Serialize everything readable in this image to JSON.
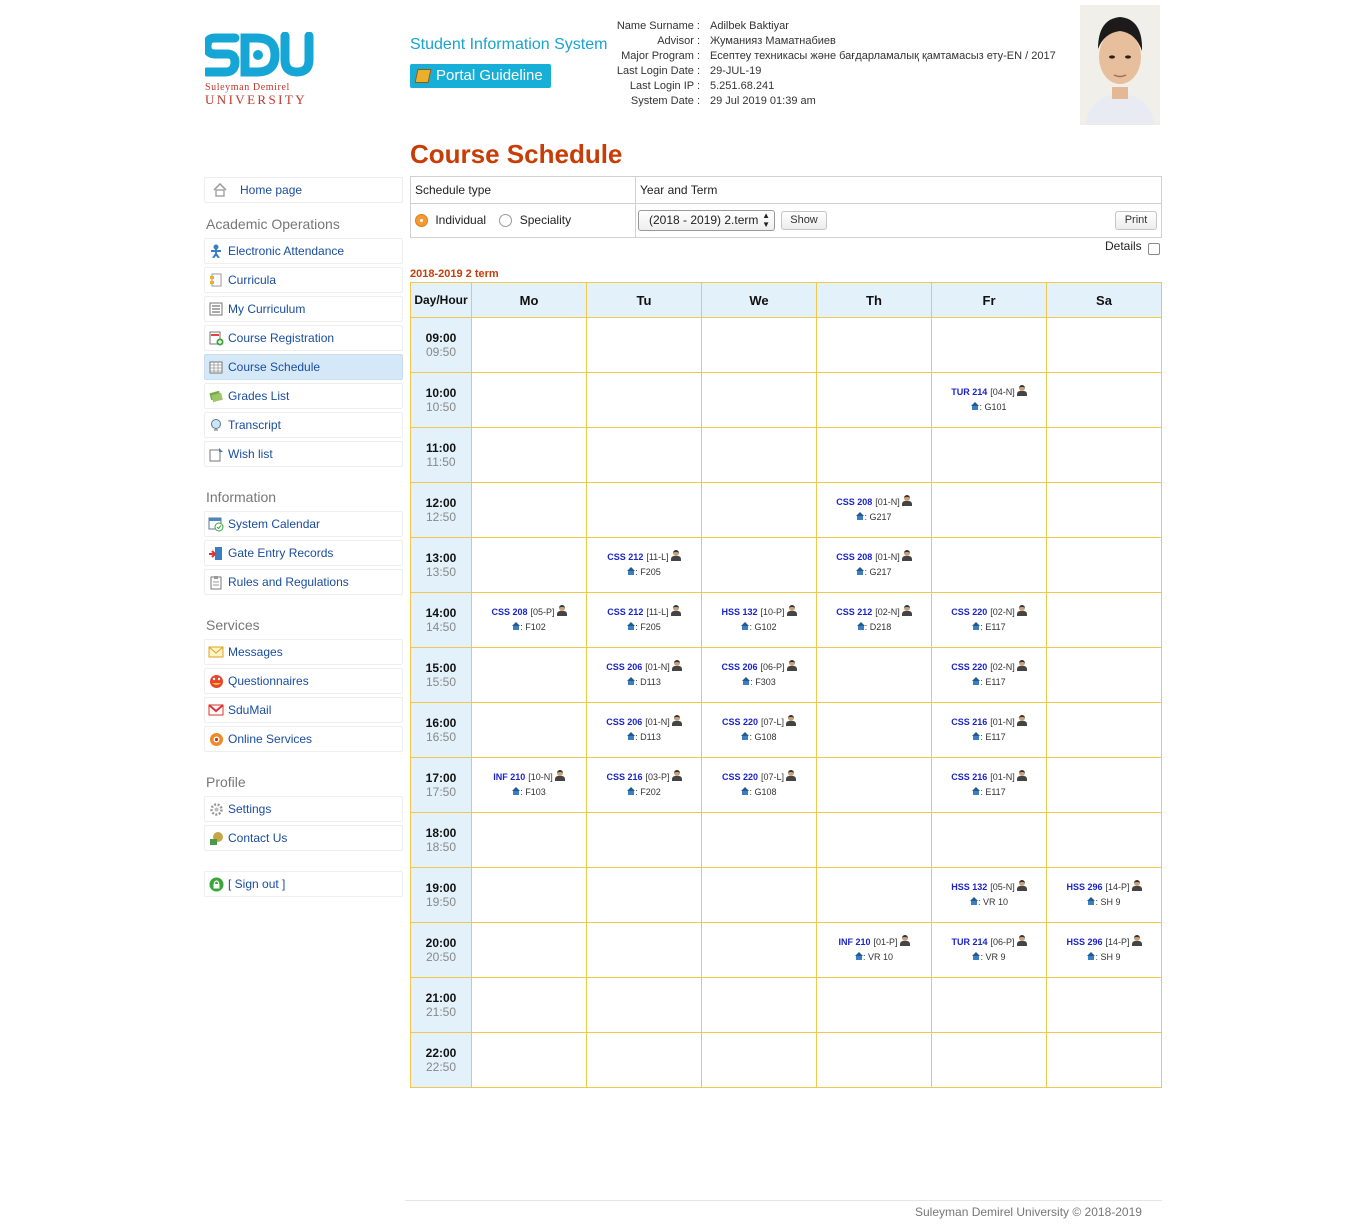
{
  "header": {
    "logo_text": "SDU",
    "university_line1": "Suleyman Demirel",
    "university_line2": "UNIVERSITY",
    "system_title": "Student Information System",
    "portal_guideline": "Portal Guideline",
    "user_info": [
      {
        "label": "Name Surname :",
        "value": "Adilbek Baktiyar"
      },
      {
        "label": "Advisor :",
        "value": "Жуманияз Маматнабиев"
      },
      {
        "label": "Major Program :",
        "value": "Есептеу техникасы және бағдарламалық қамтамасыз ету-EN / 2017"
      },
      {
        "label": "Last Login Date :",
        "value": "29-JUL-19"
      },
      {
        "label": "Last Login IP :",
        "value": "5.251.68.241"
      },
      {
        "label": "System Date :",
        "value": "29 Jul 2019 01:39 am"
      }
    ]
  },
  "page_title": "Course Schedule",
  "sidebar": {
    "home": "Home page",
    "sections": {
      "academic": "Academic Operations",
      "information": "Information",
      "services": "Services",
      "profile": "Profile"
    },
    "academic_items": [
      "Electronic Attendance",
      "Curricula",
      "My Curriculum",
      "Course Registration",
      "Course Schedule",
      "Grades List",
      "Transcript",
      "Wish list"
    ],
    "information_items": [
      "System Calendar",
      "Gate Entry Records",
      "Rules and Regulations"
    ],
    "services_items": [
      "Messages",
      "Questionnaires",
      "SduMail",
      "Online Services"
    ],
    "profile_items": [
      "Settings",
      "Contact Us"
    ],
    "sign_out": "[ Sign out ]",
    "active_item": "Course Schedule"
  },
  "filter": {
    "schedule_type_label": "Schedule type",
    "year_term_label": "Year and Term",
    "option_individual": "Individual",
    "option_speciality": "Speciality",
    "selected_type": "Individual",
    "term_select": "(2018 - 2019) 2.term",
    "show_button": "Show",
    "print_button": "Print",
    "details_label": "Details",
    "details_checked": false
  },
  "schedule": {
    "term_label": "2018-2019 2 term",
    "corner_header": "Day/Hour",
    "days": [
      "Mo",
      "Tu",
      "We",
      "Th",
      "Fr",
      "Sa"
    ],
    "hours": [
      {
        "start": "09:00",
        "end": "09:50"
      },
      {
        "start": "10:00",
        "end": "10:50"
      },
      {
        "start": "11:00",
        "end": "11:50"
      },
      {
        "start": "12:00",
        "end": "12:50"
      },
      {
        "start": "13:00",
        "end": "13:50"
      },
      {
        "start": "14:00",
        "end": "14:50"
      },
      {
        "start": "15:00",
        "end": "15:50"
      },
      {
        "start": "16:00",
        "end": "16:50"
      },
      {
        "start": "17:00",
        "end": "17:50"
      },
      {
        "start": "18:00",
        "end": "18:50"
      },
      {
        "start": "19:00",
        "end": "19:50"
      },
      {
        "start": "20:00",
        "end": "20:50"
      },
      {
        "start": "21:00",
        "end": "21:50"
      },
      {
        "start": "22:00",
        "end": "22:50"
      }
    ],
    "lessons": [
      {
        "hour": "10:00",
        "day": "Fr",
        "course": "TUR 214",
        "section": "[04-N]",
        "room": "G101"
      },
      {
        "hour": "12:00",
        "day": "Th",
        "course": "CSS 208",
        "section": "[01-N]",
        "room": "G217"
      },
      {
        "hour": "13:00",
        "day": "Tu",
        "course": "CSS 212",
        "section": "[11-L]",
        "room": "F205"
      },
      {
        "hour": "13:00",
        "day": "Th",
        "course": "CSS 208",
        "section": "[01-N]",
        "room": "G217"
      },
      {
        "hour": "14:00",
        "day": "Mo",
        "course": "CSS 208",
        "section": "[05-P]",
        "room": "F102"
      },
      {
        "hour": "14:00",
        "day": "Tu",
        "course": "CSS 212",
        "section": "[11-L]",
        "room": "F205"
      },
      {
        "hour": "14:00",
        "day": "We",
        "course": "HSS 132",
        "section": "[10-P]",
        "room": "G102"
      },
      {
        "hour": "14:00",
        "day": "Th",
        "course": "CSS 212",
        "section": "[02-N]",
        "room": "D218"
      },
      {
        "hour": "14:00",
        "day": "Fr",
        "course": "CSS 220",
        "section": "[02-N]",
        "room": "E117"
      },
      {
        "hour": "15:00",
        "day": "Tu",
        "course": "CSS 206",
        "section": "[01-N]",
        "room": "D113"
      },
      {
        "hour": "15:00",
        "day": "We",
        "course": "CSS 206",
        "section": "[06-P]",
        "room": "F303"
      },
      {
        "hour": "15:00",
        "day": "Fr",
        "course": "CSS 220",
        "section": "[02-N]",
        "room": "E117"
      },
      {
        "hour": "16:00",
        "day": "Tu",
        "course": "CSS 206",
        "section": "[01-N]",
        "room": "D113"
      },
      {
        "hour": "16:00",
        "day": "We",
        "course": "CSS 220",
        "section": "[07-L]",
        "room": "G108"
      },
      {
        "hour": "16:00",
        "day": "Fr",
        "course": "CSS 216",
        "section": "[01-N]",
        "room": "E117"
      },
      {
        "hour": "17:00",
        "day": "Mo",
        "course": "INF 210",
        "section": "[10-N]",
        "room": "F103"
      },
      {
        "hour": "17:00",
        "day": "Tu",
        "course": "CSS 216",
        "section": "[03-P]",
        "room": "F202"
      },
      {
        "hour": "17:00",
        "day": "We",
        "course": "CSS 220",
        "section": "[07-L]",
        "room": "G108"
      },
      {
        "hour": "17:00",
        "day": "Fr",
        "course": "CSS 216",
        "section": "[01-N]",
        "room": "E117"
      },
      {
        "hour": "19:00",
        "day": "Fr",
        "course": "HSS 132",
        "section": "[05-N]",
        "room": "VR 10"
      },
      {
        "hour": "19:00",
        "day": "Sa",
        "course": "HSS 296",
        "section": "[14-P]",
        "room": "SH 9"
      },
      {
        "hour": "20:00",
        "day": "Th",
        "course": "INF 210",
        "section": "[01-P]",
        "room": "VR 10"
      },
      {
        "hour": "20:00",
        "day": "Fr",
        "course": "TUR 214",
        "section": "[06-P]",
        "room": "VR 9"
      },
      {
        "hour": "20:00",
        "day": "Sa",
        "course": "HSS 296",
        "section": "[14-P]",
        "room": "SH 9"
      }
    ]
  },
  "footer": "Suleyman Demirel University © 2018-2019",
  "colors": {
    "accent": "#19a3cf",
    "title": "#c83d07",
    "grid": "#f0c94c",
    "header_bg": "#e3f1fb",
    "course_code": "#1b24c9"
  }
}
